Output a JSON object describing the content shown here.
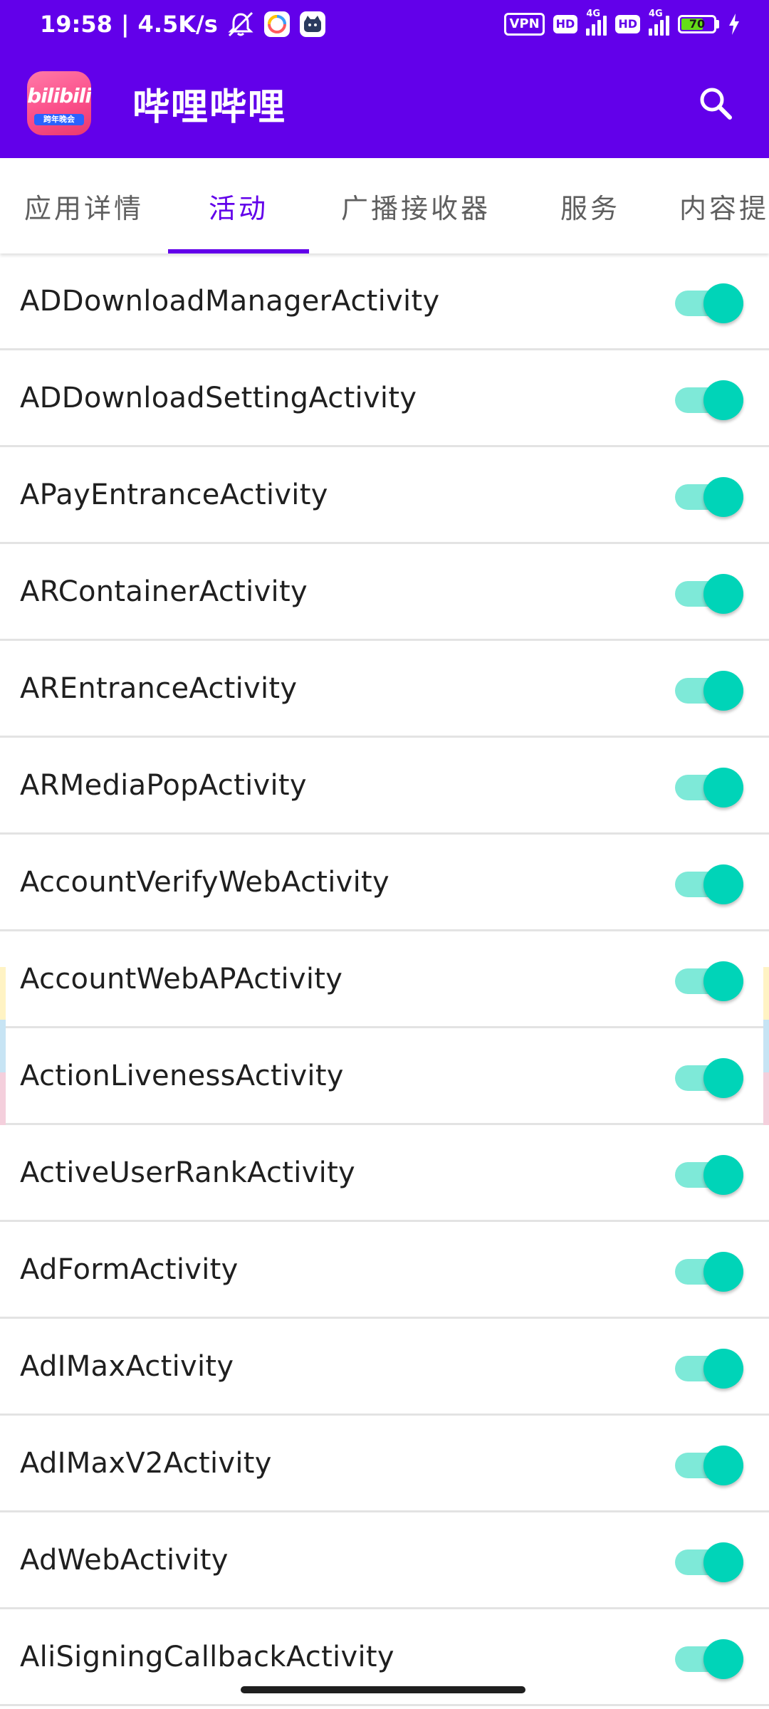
{
  "status_bar": {
    "time": "19:58",
    "network_speed": "4.5K/s",
    "vpn_label": "VPN",
    "hd_label": "HD",
    "net_type": "4G",
    "battery_level": "70",
    "battery_fraction": 0.7,
    "icons": [
      "mute-icon",
      "app-notification-icon",
      "app-notification-icon-2",
      "charging-icon"
    ]
  },
  "app_bar": {
    "title": "哔哩哔哩",
    "logo_text": "bilibili",
    "logo_ribbon_text": "跨年晚会",
    "search_icon": "search-icon"
  },
  "tabs": [
    {
      "label": "应用详情",
      "active": false
    },
    {
      "label": "活动",
      "active": true
    },
    {
      "label": "广播接收器",
      "active": false
    },
    {
      "label": "服务",
      "active": false
    },
    {
      "label": "内容提供",
      "active": false
    }
  ],
  "activities": [
    {
      "name": "ADDownloadManagerActivity",
      "enabled": true
    },
    {
      "name": "ADDownloadSettingActivity",
      "enabled": true
    },
    {
      "name": "APayEntranceActivity",
      "enabled": true
    },
    {
      "name": "ARContainerActivity",
      "enabled": true
    },
    {
      "name": "AREntranceActivity",
      "enabled": true
    },
    {
      "name": "ARMediaPopActivity",
      "enabled": true
    },
    {
      "name": "AccountVerifyWebActivity",
      "enabled": true
    },
    {
      "name": "AccountWebAPActivity",
      "enabled": true
    },
    {
      "name": "ActionLivenessActivity",
      "enabled": true
    },
    {
      "name": "ActiveUserRankActivity",
      "enabled": true
    },
    {
      "name": "AdFormActivity",
      "enabled": true
    },
    {
      "name": "AdIMaxActivity",
      "enabled": true
    },
    {
      "name": "AdIMaxV2Activity",
      "enabled": true
    },
    {
      "name": "AdWebActivity",
      "enabled": true
    },
    {
      "name": "AliSigningCallbackActivity",
      "enabled": true
    }
  ],
  "colors": {
    "primary": "#6200EA",
    "switch_thumb": "#00D4B8",
    "switch_track": "#7EE9D8",
    "divider": "#E3E3E3"
  }
}
